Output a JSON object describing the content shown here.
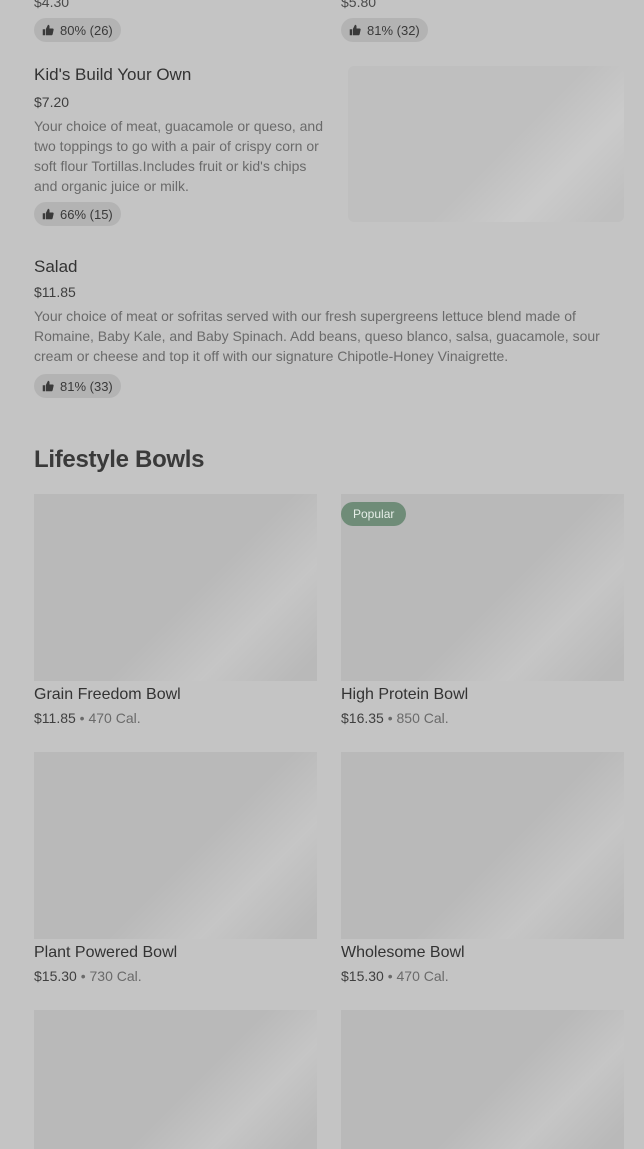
{
  "top_items": [
    {
      "price": "$4.30",
      "rating": "80% (26)"
    },
    {
      "price": "$5.80",
      "rating": "81% (32)"
    }
  ],
  "kids": {
    "title": "Kid's Build Your Own",
    "price": "$7.20",
    "desc_lines": [
      "Your choice of meat, guacamole or queso, and",
      "two toppings to go with a pair of crispy corn or",
      "soft flour Tortillas.Includes fruit or kid's chips",
      "and organic juice or milk."
    ],
    "rating": "66% (15)"
  },
  "salad": {
    "title": "Salad",
    "price": "$11.85",
    "desc_lines": [
      "Your choice of meat or sofritas served with our fresh supergreens lettuce blend made of",
      "Romaine, Baby Kale, and Baby Spinach. Add beans, queso blanco, salsa, guacamole, sour",
      "cream or cheese and top it off with our signature Chipotle-Honey Vinaigrette."
    ],
    "rating": "81% (33)"
  },
  "lifestyle": {
    "title": "Lifestyle Bowls",
    "popular_label": "Popular",
    "cards": [
      {
        "title": "Grain Freedom Bowl",
        "price": "$11.85",
        "cal": "470 Cal."
      },
      {
        "title": "High Protein Bowl",
        "price": "$16.35",
        "cal": "850 Cal."
      },
      {
        "title": "Plant Powered Bowl",
        "price": "$15.30",
        "cal": "730 Cal."
      },
      {
        "title": "Wholesome Bowl",
        "price": "$15.30",
        "cal": "470 Cal."
      }
    ]
  },
  "icons": {
    "rating": "thumbs-up-icon"
  }
}
